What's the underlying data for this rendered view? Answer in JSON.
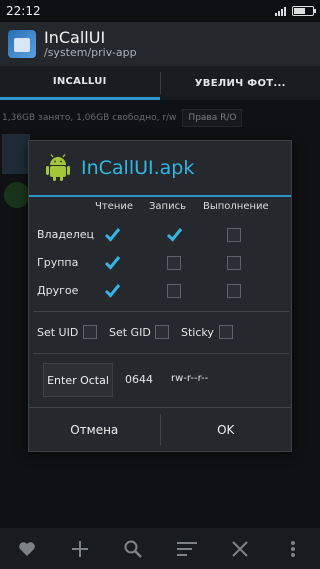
{
  "status_bar": {
    "time": "22:12"
  },
  "header": {
    "title": "InCallUI",
    "path": "/system/priv-app"
  },
  "tabs": [
    {
      "label": "INCALLUI",
      "active": true
    },
    {
      "label": "УВЕЛИЧ ФОТ...",
      "active": false
    }
  ],
  "storage": {
    "info": "1,36GB занято, 1,06GB свободно, r/w",
    "permissions_button": "Права R/O"
  },
  "dialog": {
    "title": "InCallUI.apk",
    "columns": [
      "Чтение",
      "Запись",
      "Выполнение"
    ],
    "rows": [
      {
        "label": "Владелец",
        "read": true,
        "write": true,
        "execute": false
      },
      {
        "label": "Группа",
        "read": true,
        "write": false,
        "execute": false
      },
      {
        "label": "Другое",
        "read": true,
        "write": false,
        "execute": false
      }
    ],
    "flags": [
      {
        "label": "Set UID",
        "checked": false
      },
      {
        "label": "Set GID",
        "checked": false
      },
      {
        "label": "Sticky",
        "checked": false
      }
    ],
    "octal_button": "Enter Octal",
    "octal_value": "0644",
    "symbolic": "rw-r--r--",
    "cancel_label": "Отмена",
    "ok_label": "OK"
  },
  "bottom_bar": {
    "icons": [
      "heart-icon",
      "plus-icon",
      "search-icon",
      "sort-icon",
      "close-icon",
      "more-icon"
    ]
  },
  "colors": {
    "accent": "#33b5e5",
    "tab_indicator": "#2c95c9",
    "android_green": "#a4c639"
  }
}
